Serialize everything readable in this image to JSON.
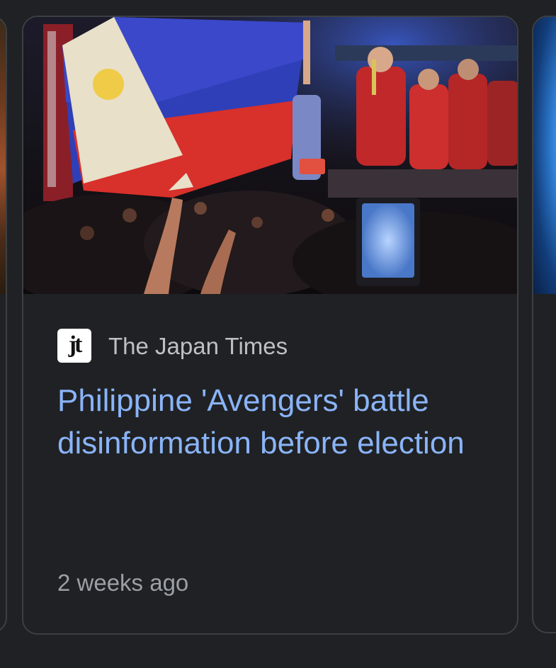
{
  "card": {
    "source_logo_text": "jt",
    "source_name": "The Japan Times",
    "headline": "Philippine 'Avengers' battle disinformation before election",
    "timestamp": "2 weeks ago",
    "thumbnail_icon": "rally-photo-icon"
  },
  "colors": {
    "background": "#202124",
    "card_border": "#3c4043",
    "headline_link": "#8ab4f8",
    "source_text": "#bdc1c6",
    "timestamp_text": "#9aa0a6"
  }
}
